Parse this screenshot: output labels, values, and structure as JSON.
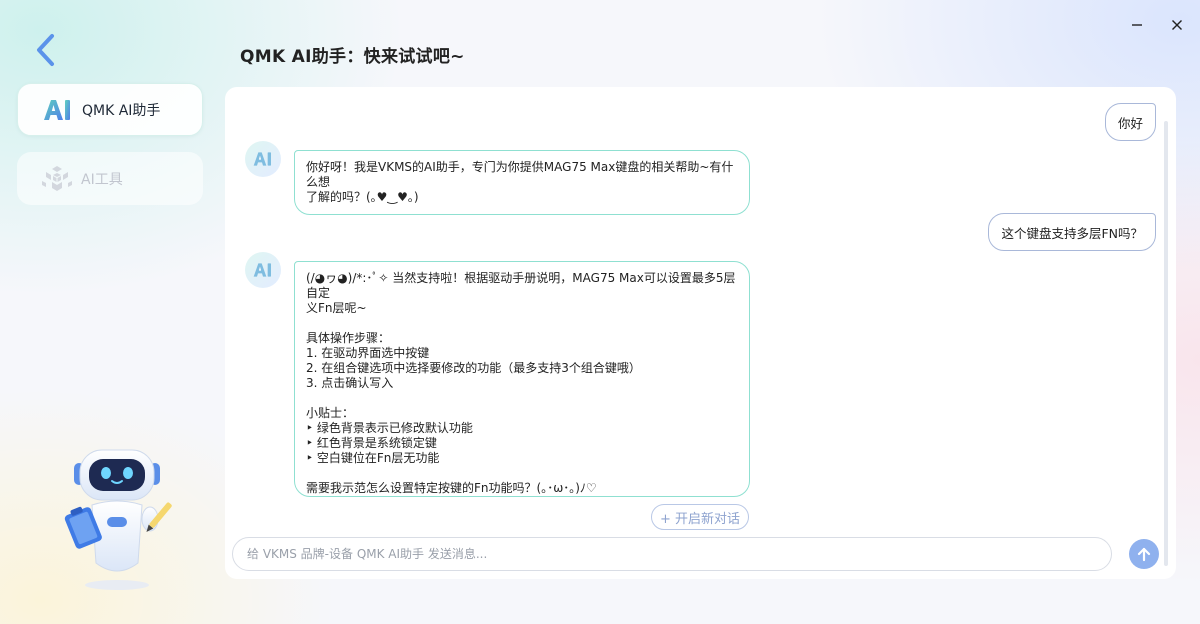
{
  "window": {
    "minimize_icon": "minimize-icon",
    "close_icon": "close-icon"
  },
  "header": {
    "back_icon": "chevron-left-icon",
    "title": "QMK AI助手：快来试试吧~"
  },
  "sidebar": {
    "items": [
      {
        "label": "QMK AI助手",
        "icon": "ai-logo-icon",
        "active": true
      },
      {
        "label": "AI工具",
        "icon": "ai-cube-icon",
        "active": false
      }
    ]
  },
  "chat": {
    "messages": [
      {
        "role": "user",
        "text": "你好"
      },
      {
        "role": "assistant",
        "lines": [
          "你好呀！我是VKMS的AI助手，专门为你提供MAG75 Max键盘的相关帮助~有什么想",
          "了解的吗？(｡♥‿♥｡)"
        ]
      },
      {
        "role": "user",
        "text": "这个键盘支持多层FN吗？"
      },
      {
        "role": "assistant",
        "lines": [
          "(/◕ヮ◕)/*:･ﾟ✧ 当然支持啦！根据驱动手册说明，MAG75 Max可以设置最多5层自定",
          "义Fn层呢~",
          "",
          "具体操作步骤：",
          "1. 在驱动界面选中按键",
          "2. 在组合键选项中选择要修改的功能（最多支持3个组合键哦）",
          "3. 点击确认写入",
          "",
          "小贴士：",
          "‣  绿色背景表示已修改默认功能",
          "‣  红色背景是系统锁定键",
          "‣  空白键位在Fn层无功能",
          "",
          "需要我示范怎么设置特定按键的Fn功能吗？(｡･ω･｡)ﾉ♡"
        ]
      }
    ],
    "new_chat_label": "+ 开启新对话",
    "input": {
      "value": "",
      "placeholder": "给 VKMS 品牌-设备 QMK AI助手 发送消息..."
    },
    "send_icon": "arrow-up-icon"
  },
  "mascot": {
    "icon": "robot-mascot-icon"
  },
  "colors": {
    "accent": "#4f8ef7",
    "ai_border": "#8fe0d1",
    "user_border": "#a9b8d9",
    "send_button": "#8fb1ee"
  }
}
